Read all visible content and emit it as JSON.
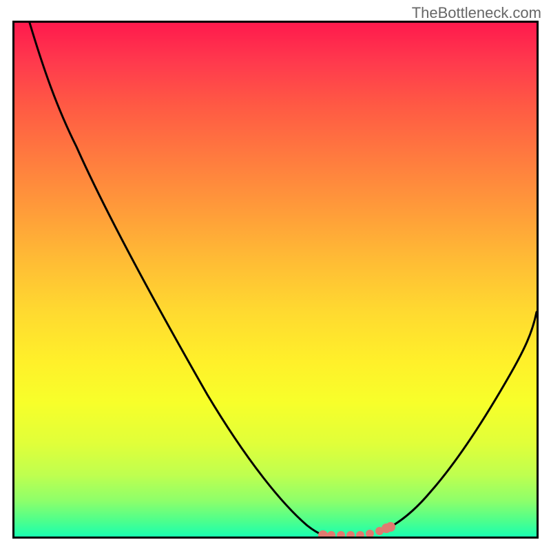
{
  "watermark": "TheBottleneck.com",
  "colors": {
    "frame_border": "#000000",
    "gradient_top": "#ff1a4d",
    "gradient_bottom": "#1affb0",
    "curve_stroke": "#000000",
    "dot_fill": "#e07a70"
  },
  "chart_data": {
    "type": "line",
    "title": "",
    "xlabel": "",
    "ylabel": "",
    "xlim": [
      0,
      100
    ],
    "ylim": [
      0,
      100
    ],
    "grid": false,
    "series": [
      {
        "name": "left_curve",
        "x": [
          3,
          10,
          20,
          30,
          40,
          50,
          56,
          59
        ],
        "y": [
          100,
          86,
          68,
          50,
          33,
          15,
          4,
          1
        ]
      },
      {
        "name": "right_curve",
        "x": [
          72,
          76,
          82,
          88,
          94,
          100
        ],
        "y": [
          2,
          5,
          12,
          22,
          32,
          44
        ]
      },
      {
        "name": "valley_dots",
        "x": [
          59,
          61,
          63,
          65,
          67,
          69,
          71,
          72
        ],
        "y": [
          1,
          1,
          0.8,
          0.8,
          0.8,
          0.9,
          1.4,
          2
        ]
      }
    ],
    "annotations": [
      {
        "text": "TheBottleneck.com",
        "position": "top-right"
      }
    ]
  }
}
